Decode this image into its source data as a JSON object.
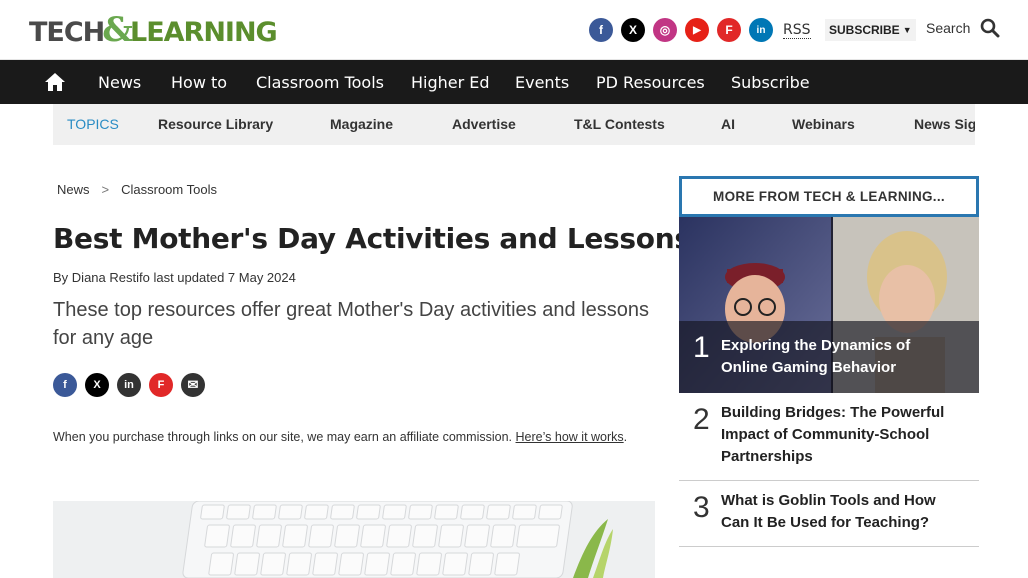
{
  "header": {
    "logo": {
      "part1": "TECH",
      "amp": "&",
      "part2": "LEARNING"
    },
    "social": [
      {
        "name": "facebook",
        "color": "#3b5998",
        "glyph": "f"
      },
      {
        "name": "x",
        "color": "#000000",
        "glyph": "X"
      },
      {
        "name": "instagram",
        "color": "#c13584",
        "glyph": "◎"
      },
      {
        "name": "youtube",
        "color": "#e62117",
        "glyph": "▶"
      },
      {
        "name": "flipboard",
        "color": "#e12828",
        "glyph": "F"
      },
      {
        "name": "linkedin",
        "color": "#0077b5",
        "glyph": "in"
      }
    ],
    "rss": "RSS",
    "subscribe": "SUBSCRIBE",
    "search": "Search"
  },
  "nav": {
    "items": [
      "News",
      "How to",
      "Classroom Tools",
      "Higher Ed",
      "Events",
      "PD Resources",
      "Subscribe"
    ]
  },
  "topics": {
    "items": [
      "TOPICS",
      "Resource Library",
      "Magazine",
      "Advertise",
      "T&L Contests",
      "AI",
      "Webinars",
      "News Sig"
    ]
  },
  "breadcrumb": {
    "items": [
      "News",
      "Classroom Tools"
    ],
    "separator": ">"
  },
  "article": {
    "title": "Best Mother's Day Activities and Lessons",
    "byline_prefix": "By",
    "author": "Diana Restifo",
    "updated": "last updated 7 May 2024",
    "standfirst": "These top resources offer great Mother's Day activities and lessons for any age",
    "affiliate_text": "When you purchase through links on our site, we may earn an affiliate commission.",
    "affiliate_link": "Here’s how it works",
    "affiliate_end": "."
  },
  "share": [
    {
      "name": "facebook",
      "color": "#3b5998",
      "glyph": "f"
    },
    {
      "name": "x",
      "color": "#000000",
      "glyph": "X"
    },
    {
      "name": "linkedin",
      "color": "#333333",
      "glyph": "in"
    },
    {
      "name": "flipboard",
      "color": "#e12828",
      "glyph": "F"
    },
    {
      "name": "email",
      "color": "#333333",
      "glyph": "✉"
    }
  ],
  "sidebar": {
    "heading": "MORE FROM TECH & LEARNING...",
    "items": [
      {
        "num": "1",
        "title": "Exploring the Dynamics of Online Gaming Behavior"
      },
      {
        "num": "2",
        "title": "Building Bridges: The Powerful Impact of Community-School Partnerships"
      },
      {
        "num": "3",
        "title": "What is Goblin Tools and How Can It Be Used for Teaching?"
      }
    ]
  }
}
